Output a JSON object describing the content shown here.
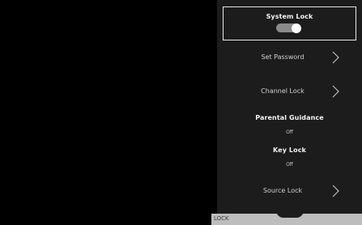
{
  "panel": {
    "system_lock": {
      "title": "System Lock",
      "toggle_state": "on"
    },
    "set_password": {
      "label": "Set Password"
    },
    "channel_lock": {
      "label": "Channel Lock"
    },
    "parental_guidance": {
      "title": "Parental Guidance",
      "value": "Off"
    },
    "key_lock": {
      "title": "Key Lock",
      "value": "Off"
    },
    "source_lock": {
      "label": "Source Lock"
    }
  },
  "footer": {
    "label": "LOCK"
  },
  "colors": {
    "panel_bg": "#1c1c1c",
    "footer_bg": "#bdbdbd",
    "focus_border": "#e8e8e8"
  },
  "icons": {
    "chevron": "chevron-right-icon"
  }
}
